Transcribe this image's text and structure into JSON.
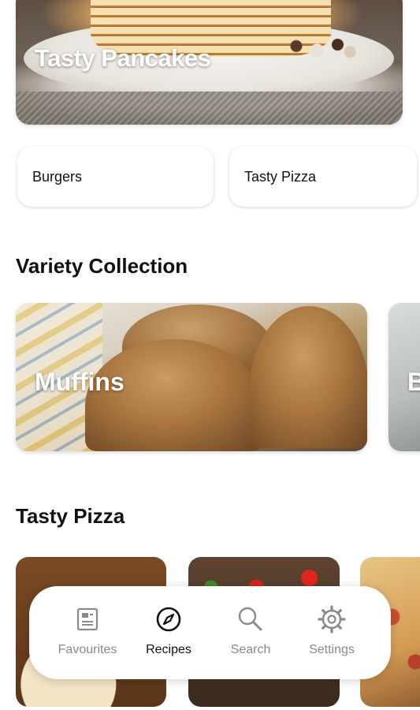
{
  "hero": {
    "title": "Tasty Pancakes"
  },
  "categories": [
    {
      "label": "Burgers"
    },
    {
      "label": "Tasty Pizza"
    }
  ],
  "variety_collection": {
    "title": "Variety Collection",
    "cards": [
      {
        "title": "Muffins"
      },
      {
        "title": "B"
      }
    ]
  },
  "tasty_pizza": {
    "title": "Tasty Pizza"
  },
  "bottom_nav": {
    "items": [
      {
        "label": "Favourites",
        "icon": "favourites-icon",
        "active": false
      },
      {
        "label": "Recipes",
        "icon": "compass-icon",
        "active": true
      },
      {
        "label": "Search",
        "icon": "search-icon",
        "active": false
      },
      {
        "label": "Settings",
        "icon": "gear-icon",
        "active": false
      }
    ],
    "colors": {
      "active": "#111111",
      "inactive": "#8a8a8a"
    }
  }
}
